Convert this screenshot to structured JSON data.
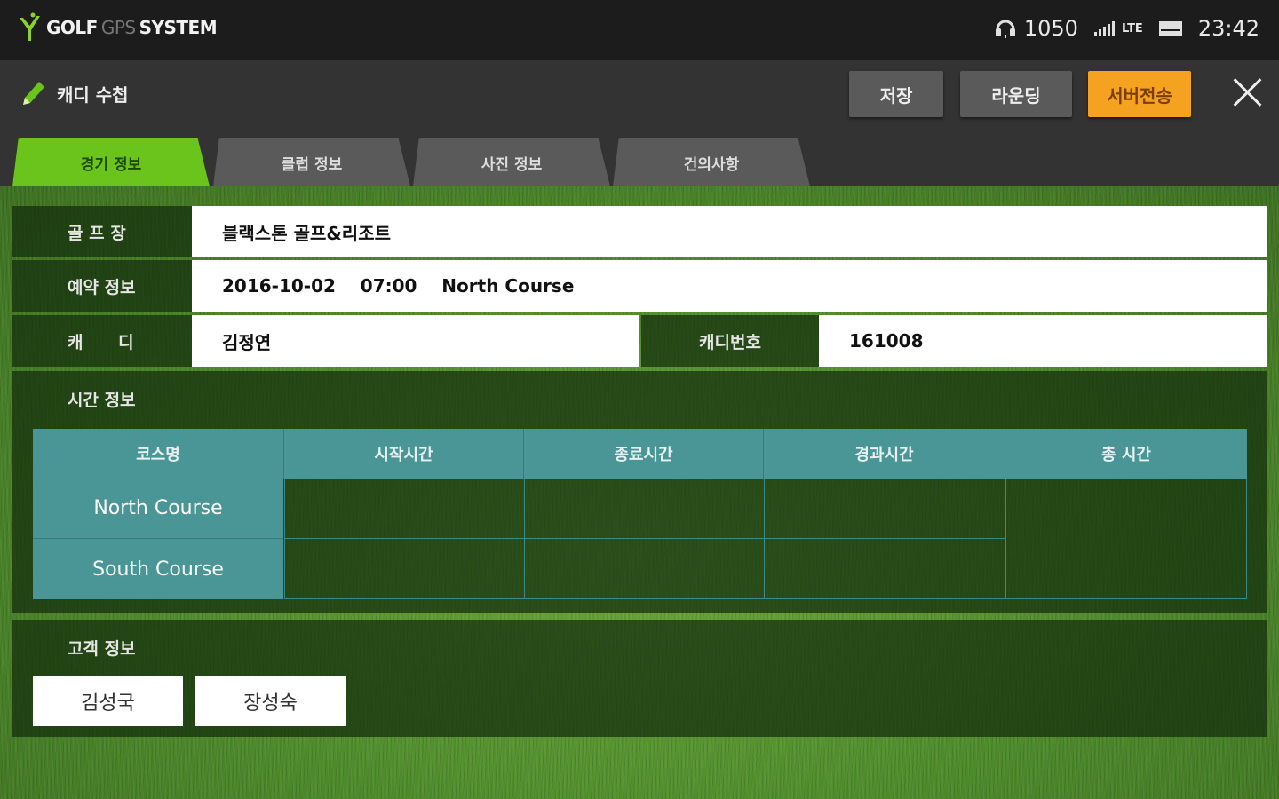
{
  "status_bar": {
    "brand_main": "GOLF",
    "brand_gps": "GPS",
    "brand_system": "SYSTEM",
    "score": "1050",
    "network": "LTE",
    "time": "23:42"
  },
  "toolbar": {
    "title": "캐디 수첩",
    "save_label": "저장",
    "rounding_label": "라운딩",
    "send_label": "서버전송"
  },
  "tabs": [
    {
      "label": "경기 정보",
      "active": true
    },
    {
      "label": "클럽 정보",
      "active": false
    },
    {
      "label": "사진 정보",
      "active": false
    },
    {
      "label": "건의사항",
      "active": false
    }
  ],
  "game_info": {
    "course_label": "골 프 장",
    "course_value": "블랙스톤 골프&리조트",
    "reservation_label": "예약 정보",
    "reservation_value": "2016-10-02    07:00    North Course",
    "caddy_label": "캐      디",
    "caddy_value": "김정연",
    "caddy_no_label": "캐디번호",
    "caddy_no_value": "161008"
  },
  "time_info": {
    "title": "시간 정보",
    "headers": [
      "코스명",
      "시작시간",
      "종료시간",
      "경과시간",
      "총 시간"
    ],
    "rows": [
      {
        "course": "North Course",
        "start": "",
        "end": "",
        "elapsed": ""
      },
      {
        "course": "South Course",
        "start": "",
        "end": "",
        "elapsed": ""
      }
    ],
    "total": ""
  },
  "customer_info": {
    "title": "고객 정보",
    "customers": [
      "김성국",
      "장성숙"
    ]
  },
  "colors": {
    "active_tab": "#6bc41b",
    "send_button": "#f4a21f",
    "table_header": "#4a9696"
  }
}
